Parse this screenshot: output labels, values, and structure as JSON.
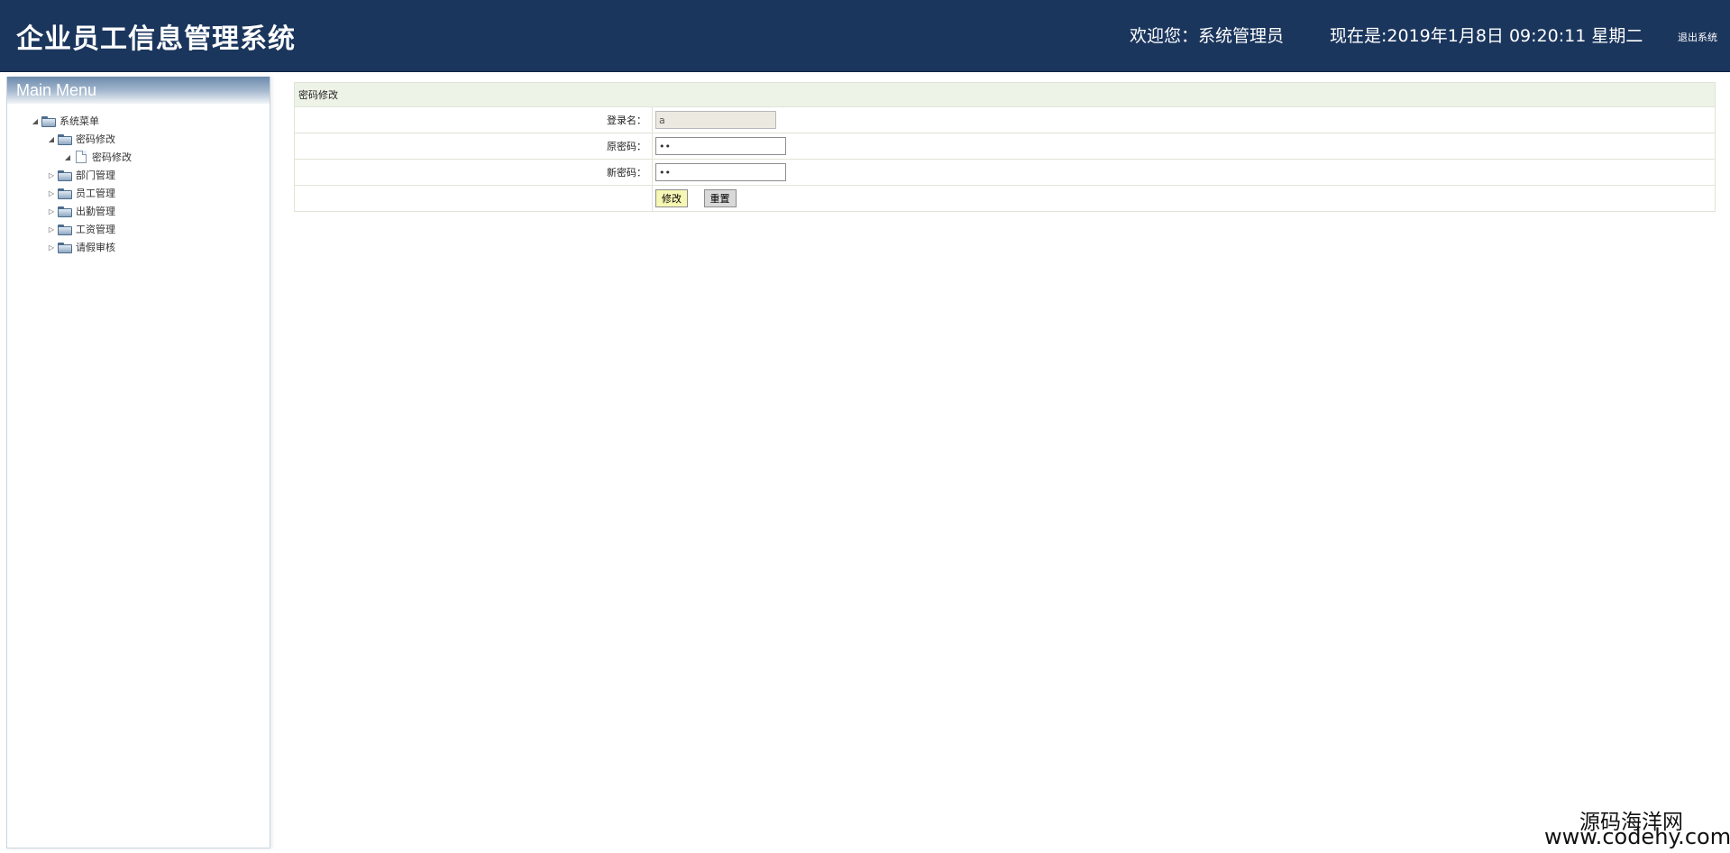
{
  "header": {
    "title": "企业员工信息管理系统",
    "welcome": "欢迎您：系统管理员",
    "clock": "现在是:2019年1月8日 09:20:11 星期二",
    "logout_label": "退出系统"
  },
  "sidebar": {
    "heading": "Main Menu",
    "tree": {
      "root": "系统菜单",
      "items": [
        {
          "label": "密码修改",
          "expanded": true,
          "children": [
            "密码修改"
          ]
        },
        {
          "label": "部门管理",
          "expanded": false
        },
        {
          "label": "员工管理",
          "expanded": false
        },
        {
          "label": "出勤管理",
          "expanded": false
        },
        {
          "label": "工资管理",
          "expanded": false
        },
        {
          "label": "请假审核",
          "expanded": false
        }
      ]
    }
  },
  "form": {
    "caption": "密码修改",
    "login_label": "登录名：",
    "login_value": "a",
    "old_password_label": "原密码：",
    "old_password_value": "••",
    "new_password_label": "新密码：",
    "new_password_value": "••",
    "submit_label": "修改",
    "reset_label": "重置"
  },
  "watermark": {
    "line1": "源码海洋网",
    "line2": "www.codehy.com"
  }
}
